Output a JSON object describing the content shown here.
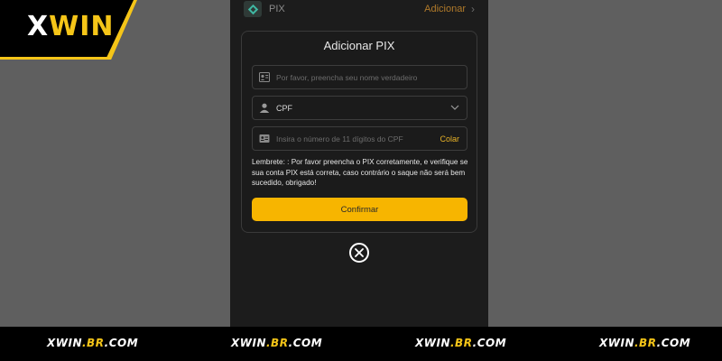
{
  "logo": {
    "part1": "X",
    "part2": "WIN"
  },
  "top_row": {
    "label": "PIX",
    "action": "Adicionar",
    "chevron": "›"
  },
  "modal": {
    "title": "Adicionar PIX",
    "name_field": {
      "placeholder": "Por favor, preencha seu nome verdadeiro",
      "icon": "id-user-icon"
    },
    "type_select": {
      "value": "CPF",
      "icon": "user-icon"
    },
    "cpf_field": {
      "placeholder": "Insira o número de 11 dígitos do CPF",
      "paste_label": "Colar",
      "icon": "id-card-icon"
    },
    "notice": "Lembrete: :  Por favor preencha o PIX corretamente, e verifique se sua conta PIX está correta, caso contrário o saque não será bem sucedido, obrigado!",
    "confirm_label": "Confirmar"
  },
  "footer": {
    "items": [
      {
        "a": "XWIN",
        "b": ".BR",
        "c": ".COM"
      },
      {
        "a": "XWIN",
        "b": ".BR",
        "c": ".COM"
      },
      {
        "a": "XWIN",
        "b": ".BR",
        "c": ".COM"
      },
      {
        "a": "XWIN",
        "b": ".BR",
        "c": ".COM"
      }
    ]
  },
  "colors": {
    "accent": "#f7b500",
    "brand_yellow": "#f5c518",
    "background": "#1b1b1b"
  }
}
